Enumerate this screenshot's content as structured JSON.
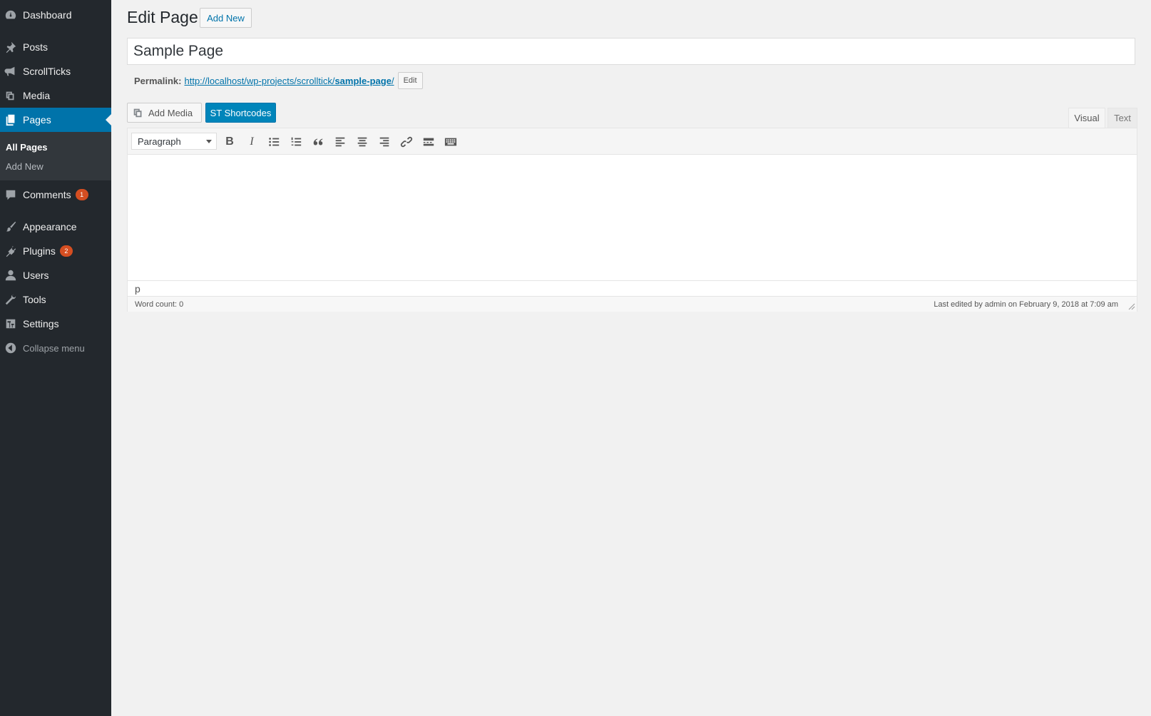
{
  "sidebar": {
    "items": [
      {
        "label": "Dashboard",
        "icon": "dashboard-icon"
      },
      {
        "label": "Posts",
        "icon": "pushpin-icon"
      },
      {
        "label": "ScrollTicks",
        "icon": "megaphone-icon"
      },
      {
        "label": "Media",
        "icon": "media-icon"
      },
      {
        "label": "Pages",
        "icon": "pages-icon",
        "active": true
      },
      {
        "label": "Comments",
        "icon": "comment-icon",
        "badge": "1"
      },
      {
        "label": "Appearance",
        "icon": "paintbrush-icon"
      },
      {
        "label": "Plugins",
        "icon": "plugin-icon",
        "badge": "2"
      },
      {
        "label": "Users",
        "icon": "users-icon"
      },
      {
        "label": "Tools",
        "icon": "wrench-icon"
      },
      {
        "label": "Settings",
        "icon": "settings-icon"
      },
      {
        "label": "Collapse menu",
        "icon": "collapse-icon"
      }
    ],
    "submenu": [
      "All Pages",
      "Add New"
    ]
  },
  "header": {
    "title": "Edit Page",
    "add_new_label": "Add New"
  },
  "post_title": "Sample Page",
  "permalink": {
    "label": "Permalink:",
    "url_base": "http://localhost/wp-projects/scrolltick/",
    "slug": "sample-page",
    "url_end": "/",
    "edit_label": "Edit"
  },
  "media_buttons": {
    "add_media": "Add Media",
    "st_shortcodes": "ST Shortcodes"
  },
  "tabs": {
    "visual": "Visual",
    "text": "Text"
  },
  "toolbar": {
    "format": "Paragraph",
    "buttons": [
      "bold",
      "italic",
      "bulleted-list",
      "numbered-list",
      "blockquote",
      "align-left",
      "align-center",
      "align-right",
      "link",
      "read-more",
      "toolbar-toggle"
    ]
  },
  "editor": {
    "path": "p",
    "word_count": "Word count: 0",
    "last_edited": "Last edited by admin on February 9, 2018 at 7:09 am"
  },
  "colors": {
    "sidebar_bg": "#23282d",
    "accent": "#0073aa",
    "badge": "#d54e21",
    "st_button": "#0085ba"
  }
}
